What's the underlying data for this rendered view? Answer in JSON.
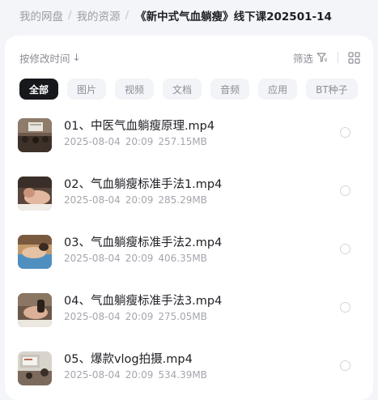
{
  "breadcrumb": {
    "items": [
      "我的网盘",
      "我的资源"
    ],
    "separator": "/",
    "current": "《新中式气血躺瘦》线下课202501-14"
  },
  "toolbar": {
    "sort_label": "按修改时间",
    "sort_arrow": "↓",
    "filter_label": "筛选",
    "filter_icon": "filter-icon",
    "view_icon": "grid-view-icon"
  },
  "chips": [
    {
      "label": "全部",
      "active": true
    },
    {
      "label": "图片",
      "active": false
    },
    {
      "label": "视频",
      "active": false
    },
    {
      "label": "文档",
      "active": false
    },
    {
      "label": "音频",
      "active": false
    },
    {
      "label": "应用",
      "active": false
    },
    {
      "label": "BT种子",
      "active": false
    }
  ],
  "files": [
    {
      "name": "01、中医气血躺瘦原理.mp4",
      "date": "2025-08-04",
      "time": "20:09",
      "size": "257.15MB",
      "thumb": "classroom-slide"
    },
    {
      "name": "02、气血躺瘦标准手法1.mp4",
      "date": "2025-08-04",
      "time": "20:09",
      "size": "285.29MB",
      "thumb": "massage-closeup"
    },
    {
      "name": "03、气血躺瘦标准手法2.mp4",
      "date": "2025-08-04",
      "time": "20:09",
      "size": "406.35MB",
      "thumb": "massage-blue-cloth"
    },
    {
      "name": "04、气血躺瘦标准手法3.mp4",
      "date": "2025-08-04",
      "time": "20:09",
      "size": "275.05MB",
      "thumb": "massage-room"
    },
    {
      "name": "05、爆款vlog拍摄.mp4",
      "date": "2025-08-04",
      "time": "20:09",
      "size": "534.39MB",
      "thumb": "classroom-screen"
    }
  ],
  "colors": {
    "background": "#f4f5f8",
    "panel": "#ffffff",
    "active_chip": "#17181c",
    "muted_text": "#a4a6ad"
  }
}
